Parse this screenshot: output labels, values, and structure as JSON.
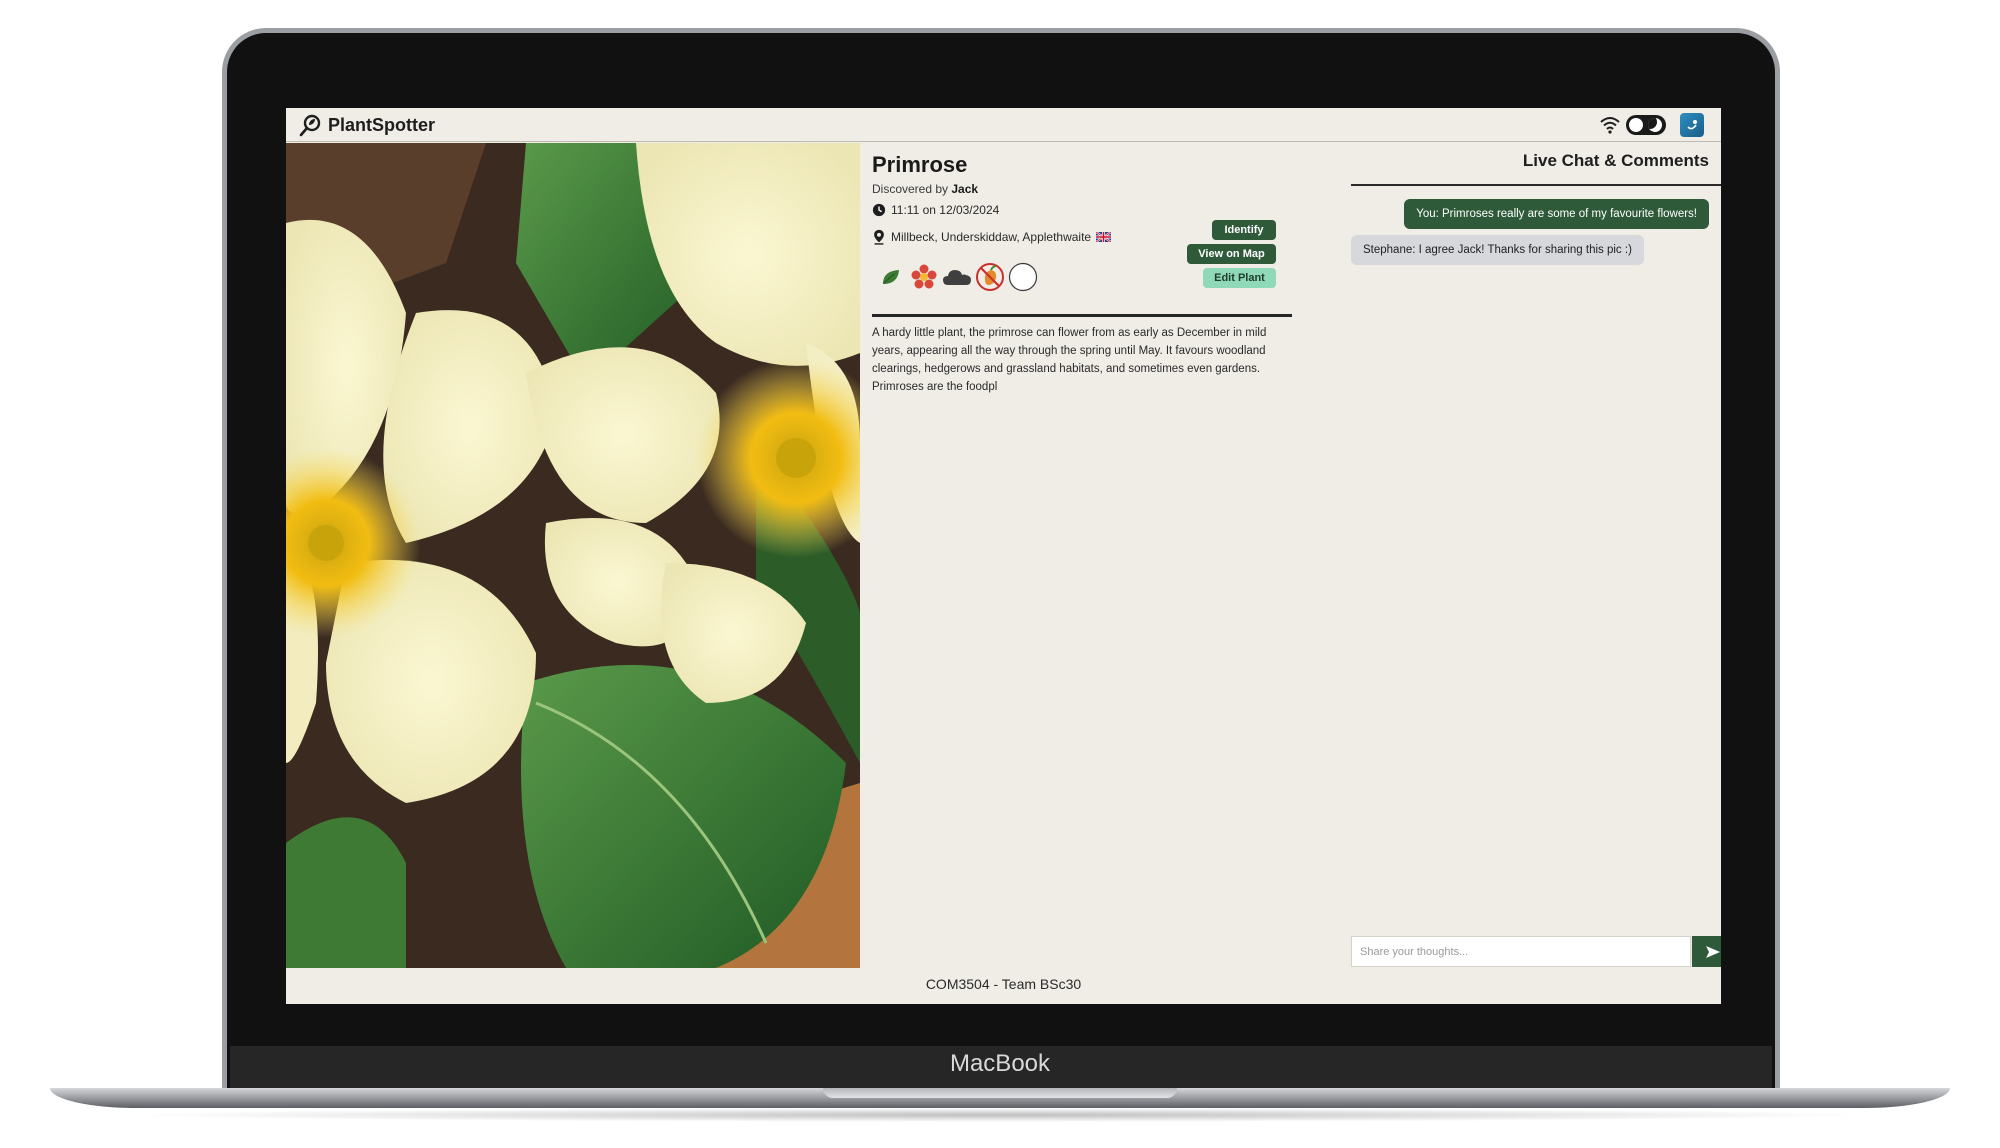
{
  "device": {
    "brand_label": "MacBook"
  },
  "app": {
    "title": "PlantSpotter",
    "icons": {
      "logo": "plant-search-icon",
      "wifi": "wifi-icon",
      "toggle": "dark-mode-toggle",
      "avatar": "user-avatar"
    }
  },
  "plant": {
    "name": "Primrose",
    "discovered_prefix": "Discovered by",
    "discovered_by": "Jack",
    "datetime": "11:11 on 12/03/2024",
    "location": "Millbeck, Underskiddaw, Applethwaite",
    "location_flag": "uk-flag-icon",
    "traits": [
      "leaf-icon",
      "flower-icon",
      "cloud-icon",
      "no-fruit-icon",
      "empty-circle-icon"
    ],
    "description": "A hardy little plant, the primrose can flower from as early as December in mild years, appearing all the way through the spring until May. It favours woodland clearings, hedgerows and grassland habitats, and sometimes even gardens. Primroses are the foodpl"
  },
  "actions": {
    "identify": "Identify",
    "view_on_map": "View on Map",
    "edit_plant": "Edit Plant"
  },
  "chat": {
    "title": "Live Chat & Comments",
    "messages": [
      {
        "text": "You: Primroses really are some of my favourite flowers!"
      },
      {
        "text": "Stephane: I agree Jack! Thanks for sharing this pic :)"
      }
    ],
    "input_placeholder": "Share your thoughts...",
    "send_icon": "send-icon"
  },
  "footer": {
    "text": "COM3504 - Team BSc30"
  },
  "colors": {
    "primary_green": "#2f5a3a",
    "light_green": "#8fd9b8",
    "background": "#efede6"
  }
}
